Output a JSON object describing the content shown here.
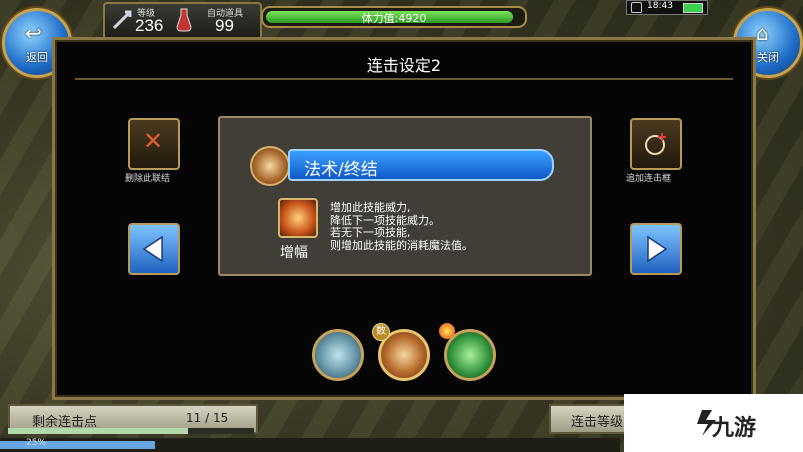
{
  "hud": {
    "level_label": "等级",
    "level": "236",
    "auto_label": "自动道具",
    "auto_value": "99",
    "stamina_text": "体力值:4920",
    "stamina_fraction": 0.98,
    "clock": "18:43"
  },
  "corners": {
    "back_label": "返回",
    "close_label": "关闭"
  },
  "dialog": {
    "title": "连击设定2",
    "delete_label": "删除此联结",
    "add_label": "追加连击框"
  },
  "skill": {
    "name": "法术/终结",
    "effect_name": "增幅",
    "effect_desc": [
      "增加此技能威力,",
      "降低下一项技能威力。",
      "若无下一项技能,",
      "则增加此技能的消耗魔法值。"
    ]
  },
  "slots": {
    "badge2": "数"
  },
  "bottom": {
    "combo_label": "剩余连击点",
    "combo_value": "11 / 15",
    "combo_fraction": 0.73,
    "combo_level_label": "连击等级",
    "xp_text": "25%",
    "xp_fraction": 0.25
  },
  "watermark": {
    "text": "九游"
  }
}
